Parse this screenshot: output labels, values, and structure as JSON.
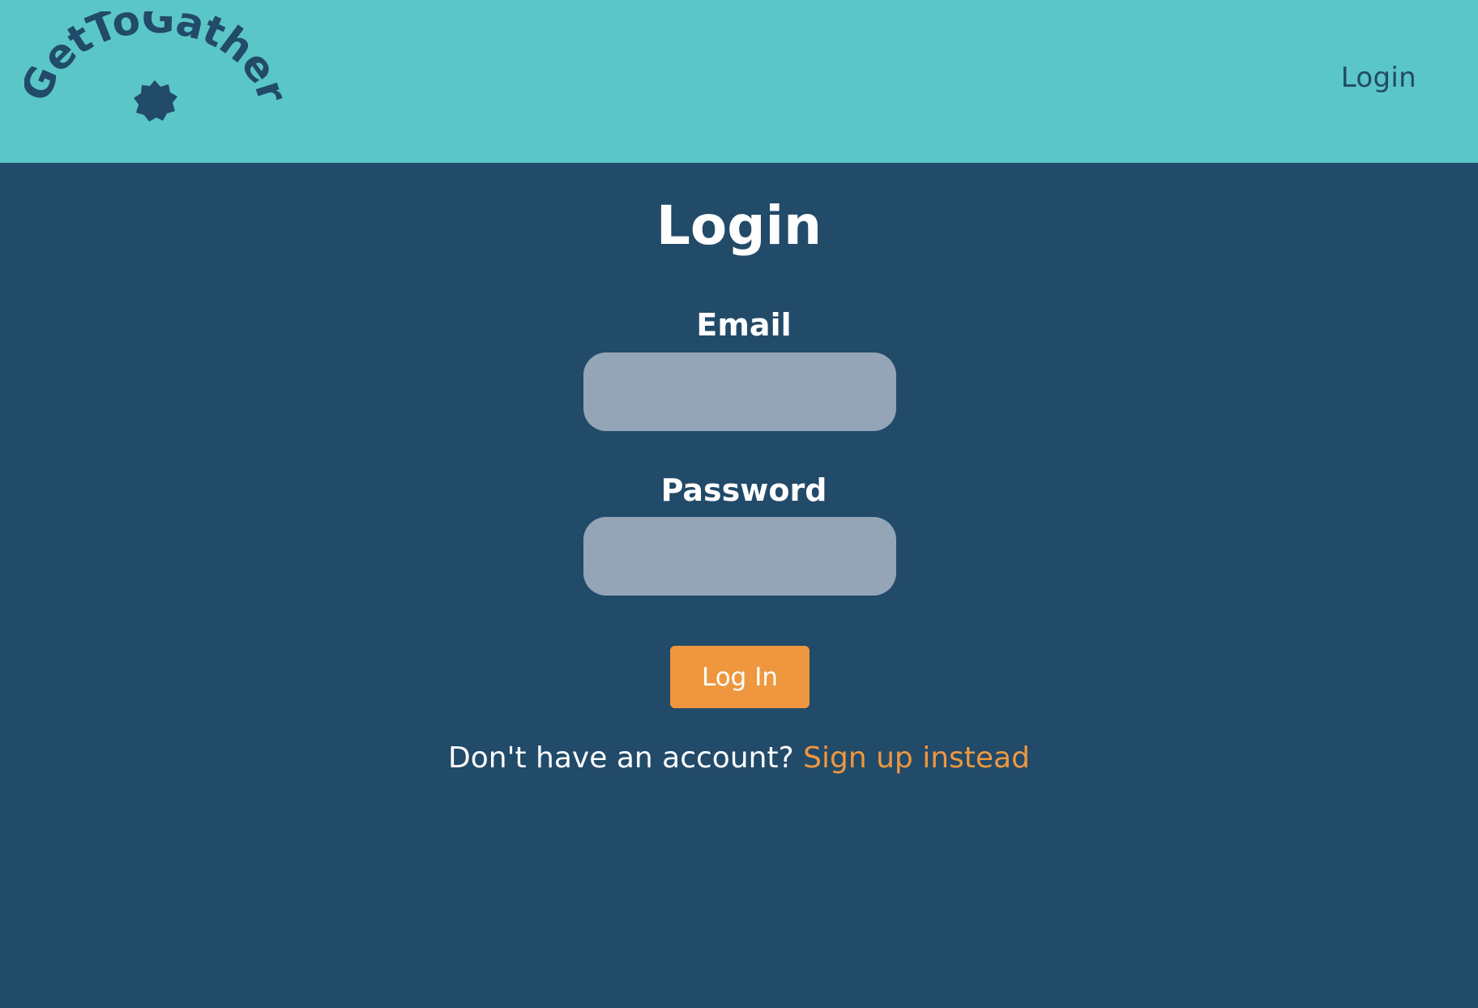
{
  "app": {
    "logo_text": "GetToGather"
  },
  "header": {
    "nav_login_label": "Login"
  },
  "form": {
    "title": "Login",
    "email_label": "Email",
    "email_value": "",
    "password_label": "Password",
    "password_value": "",
    "submit_label": "Log In"
  },
  "footer": {
    "prompt_text": "Don't have an account? ",
    "signup_link_label": "Sign up instead"
  },
  "colors": {
    "header_bg": "#5bc6c8",
    "page_bg": "#224a69",
    "input_bg": "#93a5b6",
    "accent": "#ee973f",
    "text_light": "#ffffff"
  },
  "icons": {
    "logo_badge": "star-badge-icon"
  }
}
